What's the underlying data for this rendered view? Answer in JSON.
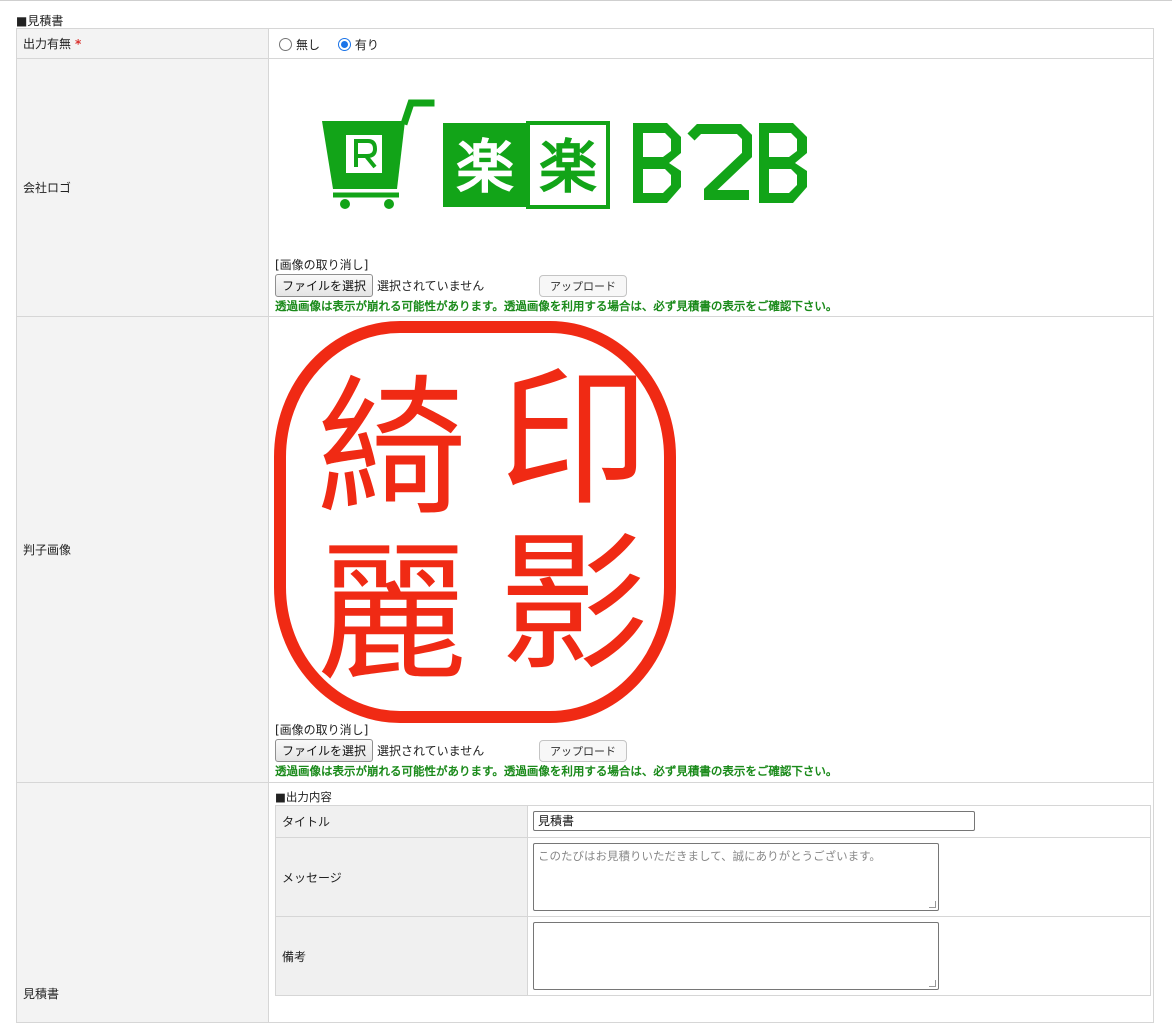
{
  "section_title": "■見積書",
  "output": {
    "label": "出力有無",
    "required_mark": "*",
    "options": [
      "無し",
      "有り"
    ],
    "selected": "有り"
  },
  "logo_row": {
    "label": "会社ロゴ",
    "cancel_link": "[画像の取り消し]",
    "choose_file": "ファイルを選択",
    "no_file": "選択されていません",
    "upload": "アップロード",
    "notice": "透過画像は表示が崩れる可能性があります。透過画像を利用する場合は、必ず見積書の表示をご確認下さい。",
    "logo_text": "楽楽B2B",
    "brand_color": "#12a418"
  },
  "stamp_row": {
    "label": "判子画像",
    "stamp_chars": [
      "印",
      "綺",
      "影",
      "麗"
    ],
    "stamp_color": "#f02a14",
    "cancel_link": "[画像の取り消し]",
    "choose_file": "ファイルを選択",
    "no_file": "選択されていません",
    "upload": "アップロード",
    "notice": "透過画像は表示が崩れる可能性があります。透過画像を利用する場合は、必ず見積書の表示をご確認下さい。"
  },
  "estimate_row": {
    "label": "見積書",
    "content_title": "■出力内容",
    "fields": {
      "title_label": "タイトル",
      "title_value": "見積書",
      "message_label": "メッセージ",
      "message_placeholder": "このたびはお見積りいただきまして、誠にありがとうございます。",
      "remarks_label": "備考",
      "remarks_value": ""
    }
  }
}
